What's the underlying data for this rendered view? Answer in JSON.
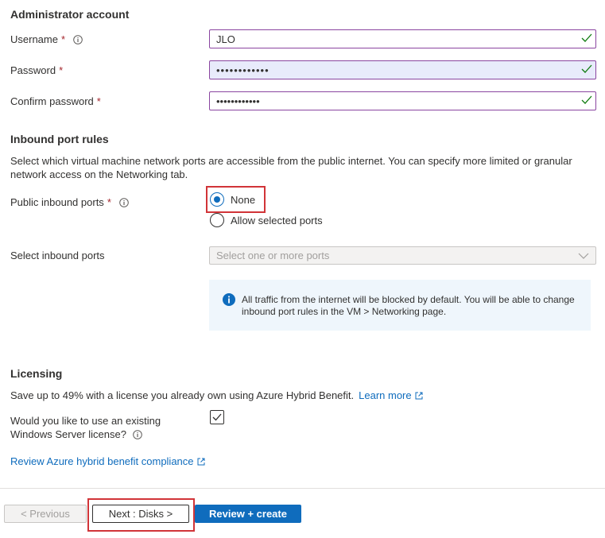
{
  "admin": {
    "title": "Administrator account",
    "username_label": "Username",
    "username_value": "JLO",
    "password_label": "Password",
    "password_value": "••••••••••••",
    "confirm_label": "Confirm password",
    "confirm_value": "••••••••••••",
    "required_mark": "*"
  },
  "inbound": {
    "title": "Inbound port rules",
    "description": "Select which virtual machine network ports are accessible from the public internet. You can specify more limited or granular network access on the Networking tab.",
    "public_ports_label": "Public inbound ports",
    "option_none": "None",
    "option_allow": "Allow selected ports",
    "selected_option": "None",
    "select_ports_label": "Select inbound ports",
    "select_ports_placeholder": "Select one or more ports",
    "info_text": "All traffic from the internet will be blocked by default. You will be able to change inbound port rules in the VM > Networking page."
  },
  "licensing": {
    "title": "Licensing",
    "description": "Save up to 49% with a license you already own using Azure Hybrid Benefit.",
    "learn_more": "Learn more",
    "question_line1": "Would you like to use an existing",
    "question_line2": "Windows Server license?",
    "checked": true,
    "compliance_link": "Review Azure hybrid benefit compliance"
  },
  "footer": {
    "previous": "< Previous",
    "next": "Next : Disks >",
    "review": "Review + create"
  },
  "colors": {
    "accent": "#0f6cbd",
    "valid_border": "#8a45a0",
    "highlight": "#d13438",
    "success": "#107c10"
  }
}
